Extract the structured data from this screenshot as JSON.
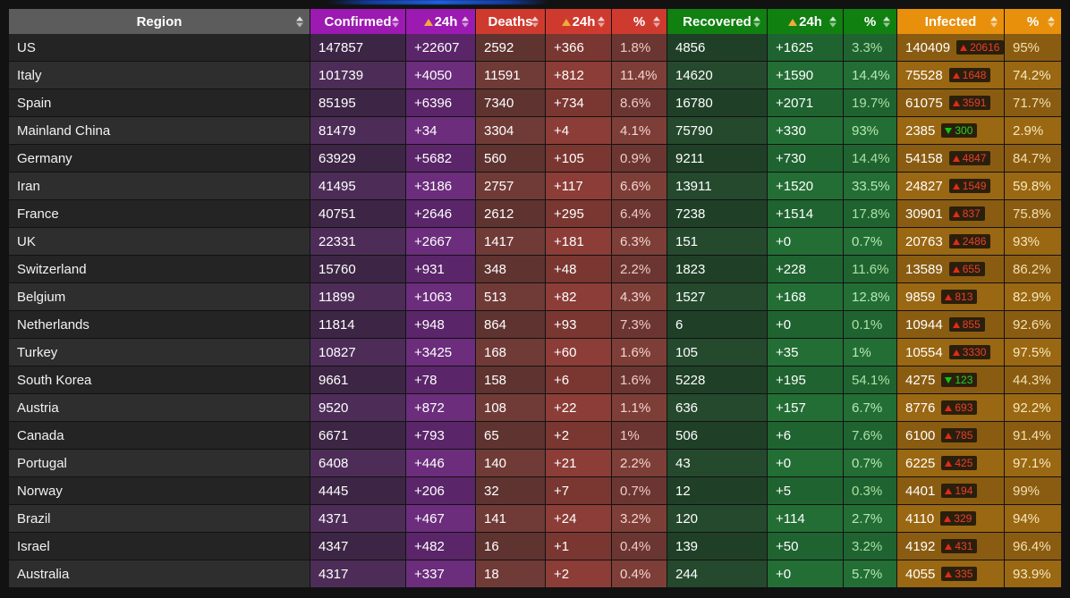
{
  "meta": {
    "accent_blue": "#1f5fe0",
    "page_background": "#121212"
  },
  "columns": [
    {
      "key": "region",
      "label": "Region",
      "color": "#5c5c5c",
      "has_delta_icon": false
    },
    {
      "key": "confirmed",
      "label": "Confirmed",
      "color": "#9c1ab1",
      "has_delta_icon": false
    },
    {
      "key": "conf24",
      "label": "24h",
      "color": "#9c1ab1",
      "has_delta_icon": true
    },
    {
      "key": "deaths",
      "label": "Deaths",
      "color": "#cf3a2f",
      "has_delta_icon": false
    },
    {
      "key": "death24",
      "label": "24h",
      "color": "#cf3a2f",
      "has_delta_icon": true
    },
    {
      "key": "deathpct",
      "label": "%",
      "color": "#cf3a2f",
      "has_delta_icon": false
    },
    {
      "key": "recovered",
      "label": "Recovered",
      "color": "#108010",
      "has_delta_icon": false
    },
    {
      "key": "rec24",
      "label": "24h",
      "color": "#108010",
      "has_delta_icon": true
    },
    {
      "key": "recpct",
      "label": "%",
      "color": "#108010",
      "has_delta_icon": false
    },
    {
      "key": "infected",
      "label": "Infected",
      "color": "#e8900c",
      "has_delta_icon": false
    },
    {
      "key": "infpct",
      "label": "%",
      "color": "#e8900c",
      "has_delta_icon": false
    }
  ],
  "sort_icon_name": "sort-updown-icon",
  "rows": [
    {
      "region": "US",
      "confirmed": "147857",
      "conf24": "+22607",
      "deaths": "2592",
      "death24": "+366",
      "deathpct": "1.8%",
      "recovered": "4856",
      "rec24": "+1625",
      "recpct": "3.3%",
      "infected": "140409",
      "inf_delta": "20616",
      "inf_dir": "up",
      "infpct": "95%"
    },
    {
      "region": "Italy",
      "confirmed": "101739",
      "conf24": "+4050",
      "deaths": "11591",
      "death24": "+812",
      "deathpct": "11.4%",
      "recovered": "14620",
      "rec24": "+1590",
      "recpct": "14.4%",
      "infected": "75528",
      "inf_delta": "1648",
      "inf_dir": "up",
      "infpct": "74.2%"
    },
    {
      "region": "Spain",
      "confirmed": "85195",
      "conf24": "+6396",
      "deaths": "7340",
      "death24": "+734",
      "deathpct": "8.6%",
      "recovered": "16780",
      "rec24": "+2071",
      "recpct": "19.7%",
      "infected": "61075",
      "inf_delta": "3591",
      "inf_dir": "up",
      "infpct": "71.7%"
    },
    {
      "region": "Mainland China",
      "confirmed": "81479",
      "conf24": "+34",
      "deaths": "3304",
      "death24": "+4",
      "deathpct": "4.1%",
      "recovered": "75790",
      "rec24": "+330",
      "recpct": "93%",
      "infected": "2385",
      "inf_delta": "300",
      "inf_dir": "down",
      "infpct": "2.9%"
    },
    {
      "region": "Germany",
      "confirmed": "63929",
      "conf24": "+5682",
      "deaths": "560",
      "death24": "+105",
      "deathpct": "0.9%",
      "recovered": "9211",
      "rec24": "+730",
      "recpct": "14.4%",
      "infected": "54158",
      "inf_delta": "4847",
      "inf_dir": "up",
      "infpct": "84.7%"
    },
    {
      "region": "Iran",
      "confirmed": "41495",
      "conf24": "+3186",
      "deaths": "2757",
      "death24": "+117",
      "deathpct": "6.6%",
      "recovered": "13911",
      "rec24": "+1520",
      "recpct": "33.5%",
      "infected": "24827",
      "inf_delta": "1549",
      "inf_dir": "up",
      "infpct": "59.8%"
    },
    {
      "region": "France",
      "confirmed": "40751",
      "conf24": "+2646",
      "deaths": "2612",
      "death24": "+295",
      "deathpct": "6.4%",
      "recovered": "7238",
      "rec24": "+1514",
      "recpct": "17.8%",
      "infected": "30901",
      "inf_delta": "837",
      "inf_dir": "up",
      "infpct": "75.8%"
    },
    {
      "region": "UK",
      "confirmed": "22331",
      "conf24": "+2667",
      "deaths": "1417",
      "death24": "+181",
      "deathpct": "6.3%",
      "recovered": "151",
      "rec24": "+0",
      "recpct": "0.7%",
      "infected": "20763",
      "inf_delta": "2486",
      "inf_dir": "up",
      "infpct": "93%"
    },
    {
      "region": "Switzerland",
      "confirmed": "15760",
      "conf24": "+931",
      "deaths": "348",
      "death24": "+48",
      "deathpct": "2.2%",
      "recovered": "1823",
      "rec24": "+228",
      "recpct": "11.6%",
      "infected": "13589",
      "inf_delta": "655",
      "inf_dir": "up",
      "infpct": "86.2%"
    },
    {
      "region": "Belgium",
      "confirmed": "11899",
      "conf24": "+1063",
      "deaths": "513",
      "death24": "+82",
      "deathpct": "4.3%",
      "recovered": "1527",
      "rec24": "+168",
      "recpct": "12.8%",
      "infected": "9859",
      "inf_delta": "813",
      "inf_dir": "up",
      "infpct": "82.9%"
    },
    {
      "region": "Netherlands",
      "confirmed": "11814",
      "conf24": "+948",
      "deaths": "864",
      "death24": "+93",
      "deathpct": "7.3%",
      "recovered": "6",
      "rec24": "+0",
      "recpct": "0.1%",
      "infected": "10944",
      "inf_delta": "855",
      "inf_dir": "up",
      "infpct": "92.6%"
    },
    {
      "region": "Turkey",
      "confirmed": "10827",
      "conf24": "+3425",
      "deaths": "168",
      "death24": "+60",
      "deathpct": "1.6%",
      "recovered": "105",
      "rec24": "+35",
      "recpct": "1%",
      "infected": "10554",
      "inf_delta": "3330",
      "inf_dir": "up",
      "infpct": "97.5%"
    },
    {
      "region": "South Korea",
      "confirmed": "9661",
      "conf24": "+78",
      "deaths": "158",
      "death24": "+6",
      "deathpct": "1.6%",
      "recovered": "5228",
      "rec24": "+195",
      "recpct": "54.1%",
      "infected": "4275",
      "inf_delta": "123",
      "inf_dir": "down",
      "infpct": "44.3%"
    },
    {
      "region": "Austria",
      "confirmed": "9520",
      "conf24": "+872",
      "deaths": "108",
      "death24": "+22",
      "deathpct": "1.1%",
      "recovered": "636",
      "rec24": "+157",
      "recpct": "6.7%",
      "infected": "8776",
      "inf_delta": "693",
      "inf_dir": "up",
      "infpct": "92.2%"
    },
    {
      "region": "Canada",
      "confirmed": "6671",
      "conf24": "+793",
      "deaths": "65",
      "death24": "+2",
      "deathpct": "1%",
      "recovered": "506",
      "rec24": "+6",
      "recpct": "7.6%",
      "infected": "6100",
      "inf_delta": "785",
      "inf_dir": "up",
      "infpct": "91.4%"
    },
    {
      "region": "Portugal",
      "confirmed": "6408",
      "conf24": "+446",
      "deaths": "140",
      "death24": "+21",
      "deathpct": "2.2%",
      "recovered": "43",
      "rec24": "+0",
      "recpct": "0.7%",
      "infected": "6225",
      "inf_delta": "425",
      "inf_dir": "up",
      "infpct": "97.1%"
    },
    {
      "region": "Norway",
      "confirmed": "4445",
      "conf24": "+206",
      "deaths": "32",
      "death24": "+7",
      "deathpct": "0.7%",
      "recovered": "12",
      "rec24": "+5",
      "recpct": "0.3%",
      "infected": "4401",
      "inf_delta": "194",
      "inf_dir": "up",
      "infpct": "99%"
    },
    {
      "region": "Brazil",
      "confirmed": "4371",
      "conf24": "+467",
      "deaths": "141",
      "death24": "+24",
      "deathpct": "3.2%",
      "recovered": "120",
      "rec24": "+114",
      "recpct": "2.7%",
      "infected": "4110",
      "inf_delta": "329",
      "inf_dir": "up",
      "infpct": "94%"
    },
    {
      "region": "Israel",
      "confirmed": "4347",
      "conf24": "+482",
      "deaths": "16",
      "death24": "+1",
      "deathpct": "0.4%",
      "recovered": "139",
      "rec24": "+50",
      "recpct": "3.2%",
      "infected": "4192",
      "inf_delta": "431",
      "inf_dir": "up",
      "infpct": "96.4%"
    },
    {
      "region": "Australia",
      "confirmed": "4317",
      "conf24": "+337",
      "deaths": "18",
      "death24": "+2",
      "deathpct": "0.4%",
      "recovered": "244",
      "rec24": "+0",
      "recpct": "5.7%",
      "infected": "4055",
      "inf_delta": "335",
      "inf_dir": "up",
      "infpct": "93.9%"
    }
  ]
}
